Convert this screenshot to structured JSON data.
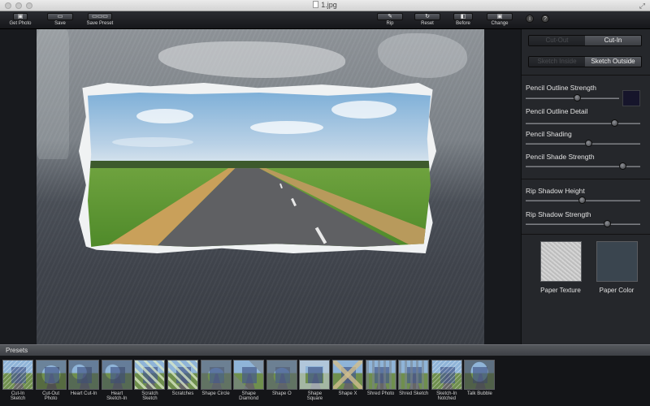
{
  "window": {
    "title": "1.jpg"
  },
  "toolbar": {
    "get_photo": "Get Photo",
    "save": "Save",
    "save_preset": "Save Preset",
    "rip": "Rip",
    "reset": "Reset",
    "before": "Before",
    "change": "Change",
    "info_glyph": "i",
    "help_glyph": "?"
  },
  "panel": {
    "mode": {
      "left": "Cut-Out",
      "right": "Cut-In",
      "selected": "Cut-In"
    },
    "sketch": {
      "left": "Sketch Inside",
      "right": "Sketch Outside",
      "selected": "Sketch Outside"
    },
    "sliders": [
      {
        "label": "Pencil Outline Strength",
        "value": 0.55
      },
      {
        "label": "Pencil Outline Detail",
        "value": 0.78
      },
      {
        "label": "Pencil Shading",
        "value": 0.55
      },
      {
        "label": "Pencil Shade Strength",
        "value": 0.85
      },
      {
        "label": "Rip Shadow Height",
        "value": 0.49
      },
      {
        "label": "Rip Shadow Strength",
        "value": 0.71
      }
    ],
    "pencil_color": "#16152b",
    "paper_texture_label": "Paper Texture",
    "paper_color_label": "Paper Color",
    "paper_color": "#3a454f"
  },
  "presets": {
    "title": "Presets",
    "items": [
      {
        "label": "Cut-In\nSketch",
        "style": "sketch"
      },
      {
        "label": "Cut-Out\nPhoto",
        "style": "photo"
      },
      {
        "label": "Heart Cut-In",
        "style": "heart"
      },
      {
        "label": "Heart\nSketch-In",
        "style": "heart"
      },
      {
        "label": "Scratch\nSketch",
        "style": "scratch"
      },
      {
        "label": "Scratches",
        "style": "scratch"
      },
      {
        "label": "Shape Circle",
        "style": "circle"
      },
      {
        "label": "Shape\nDiamond",
        "style": "diamond"
      },
      {
        "label": "Shape O",
        "style": "circle"
      },
      {
        "label": "Shape\nSquare",
        "style": "square"
      },
      {
        "label": "Shape X",
        "style": "x"
      },
      {
        "label": "Shred Photo",
        "style": "shred"
      },
      {
        "label": "Shred Sketch",
        "style": "shred"
      },
      {
        "label": "Sketch-In\nNotched",
        "style": "sketch"
      },
      {
        "label": "Talk Bubble",
        "style": "bubble"
      }
    ]
  }
}
